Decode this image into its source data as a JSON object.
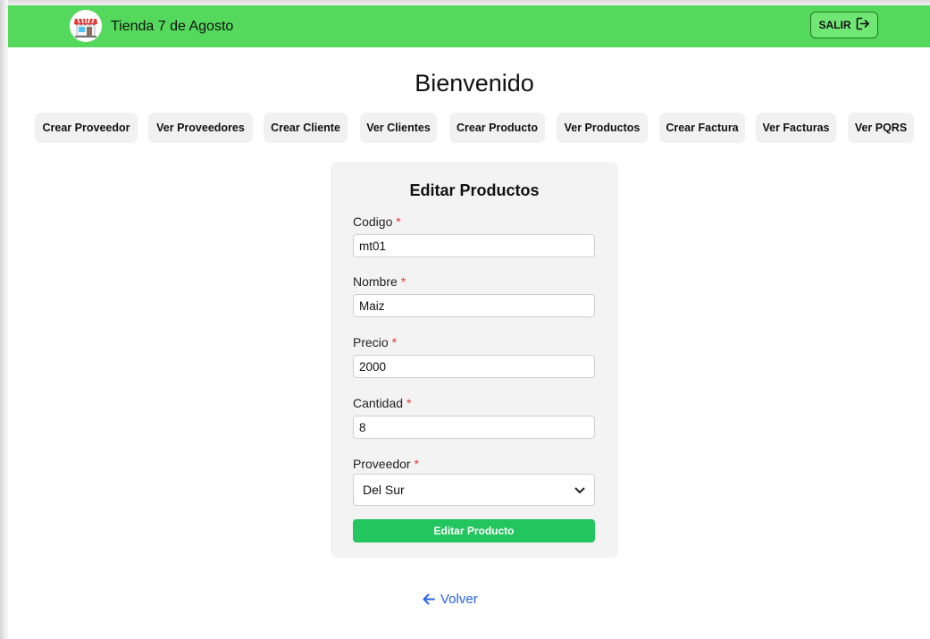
{
  "header": {
    "brand_name": "Tienda 7 de Agosto",
    "logout_label": "SALIR"
  },
  "page": {
    "title": "Bienvenido"
  },
  "menu": {
    "items": [
      {
        "label": "Crear Proveedor"
      },
      {
        "label": "Ver Proveedores"
      },
      {
        "label": "Crear Cliente"
      },
      {
        "label": "Ver Clientes"
      },
      {
        "label": "Crear Producto"
      },
      {
        "label": "Ver Productos"
      },
      {
        "label": "Crear Factura"
      },
      {
        "label": "Ver Facturas"
      },
      {
        "label": "Ver PQRS"
      }
    ]
  },
  "form": {
    "title": "Editar Productos",
    "required_mark": "*",
    "fields": {
      "codigo": {
        "label": "Codigo",
        "value": "mt01"
      },
      "nombre": {
        "label": "Nombre",
        "value": "Maiz"
      },
      "precio": {
        "label": "Precio",
        "value": "2000"
      },
      "cantidad": {
        "label": "Cantidad",
        "value": "8"
      },
      "proveedor": {
        "label": "Proveedor",
        "value": "Del Sur"
      }
    },
    "submit_label": "Editar Producto"
  },
  "footer": {
    "back_label": "Volver"
  },
  "colors": {
    "navbar": "#55d95c",
    "submit": "#22c55e",
    "link": "#2563eb",
    "required": "#e53935"
  },
  "icons": {
    "logo": "store-awning-icon",
    "logout": "logout-icon",
    "select": "chevron-down-icon",
    "back": "arrow-left-icon"
  }
}
